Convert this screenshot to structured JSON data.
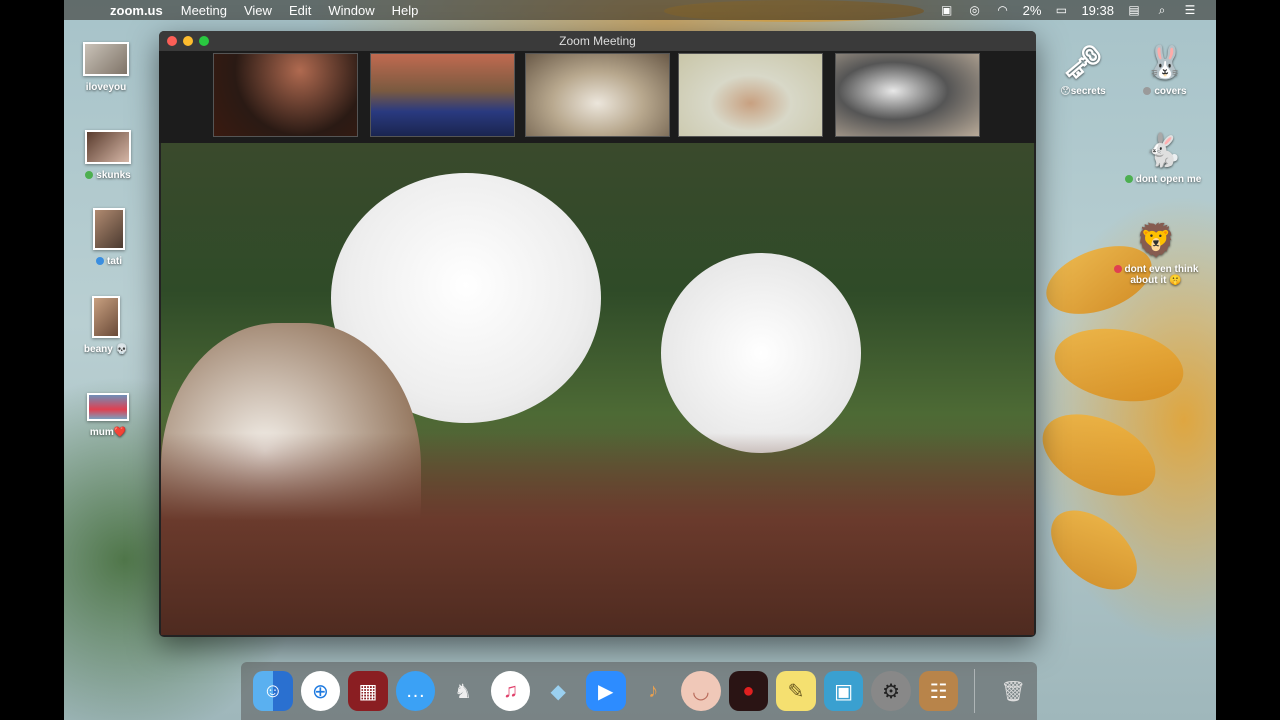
{
  "menubar": {
    "app_name": "zoom.us",
    "menus": [
      "Meeting",
      "View",
      "Edit",
      "Window",
      "Help"
    ],
    "battery": "2%",
    "clock": "19:38"
  },
  "desktop_left": [
    {
      "label": "iloveyou",
      "dot": ""
    },
    {
      "label": "skunks",
      "dot": "#4caf50"
    },
    {
      "label": "tati",
      "dot": "#3a8ee0"
    },
    {
      "label": "beany 💀",
      "dot": ""
    },
    {
      "label": "mum❤️",
      "dot": ""
    }
  ],
  "desktop_right": [
    {
      "label": "secrets",
      "prefix": "😯"
    },
    {
      "label": "covers",
      "prefix": ""
    },
    {
      "label": "dont open me",
      "prefix": ""
    },
    {
      "label": "dont even think about it 🤫",
      "prefix": ""
    }
  ],
  "window": {
    "title": "Zoom Meeting"
  },
  "dock": {
    "apps": [
      "finder-icon",
      "safari-icon",
      "photo-booth-icon",
      "messages-icon",
      "app-icon",
      "itunes-icon",
      "seal-app-icon",
      "zoom-icon",
      "garageband-icon",
      "face-app-icon",
      "photo-app-icon",
      "stickies-icon",
      "preview-icon",
      "system-preferences-icon",
      "contacts-icon"
    ],
    "trash": "trash-icon"
  }
}
